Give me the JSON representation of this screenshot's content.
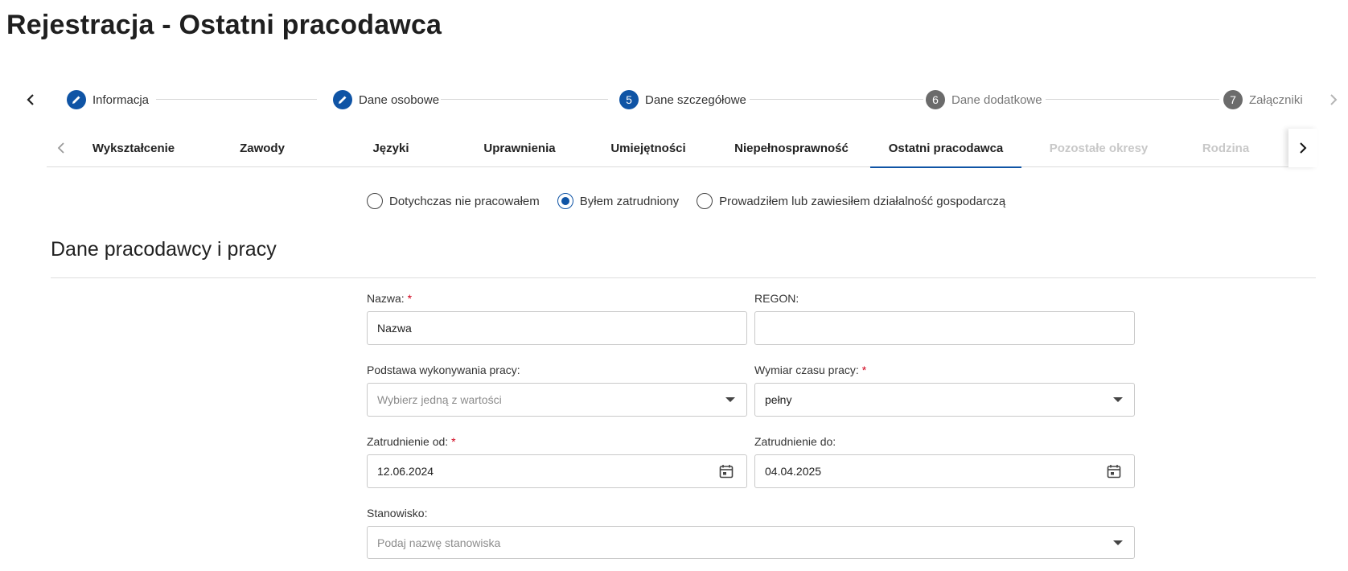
{
  "page": {
    "title": "Rejestracja - Ostatni pracodawca"
  },
  "stepper": {
    "prev_icon": "chevron-left-icon",
    "next_icon": "chevron-right-icon",
    "steps": [
      {
        "label": "Informacja",
        "state": "done",
        "icon": "pencil-icon"
      },
      {
        "label": "Dane osobowe",
        "state": "done",
        "icon": "pencil-icon"
      },
      {
        "label": "Dane szczegółowe",
        "state": "active",
        "number": "5"
      },
      {
        "label": "Dane dodatkowe",
        "state": "todo",
        "number": "6"
      },
      {
        "label": "Załączniki",
        "state": "todo",
        "number": "7"
      }
    ]
  },
  "tabs": {
    "items": [
      {
        "label": "Wykształcenie"
      },
      {
        "label": "Zawody"
      },
      {
        "label": "Języki"
      },
      {
        "label": "Uprawnienia"
      },
      {
        "label": "Umiejętności"
      },
      {
        "label": "Niepełnosprawność"
      },
      {
        "label": "Ostatni pracodawca",
        "active": true
      },
      {
        "label": "Pozostałe okresy",
        "disabled": true
      },
      {
        "label": "Rodzina",
        "disabled": true
      }
    ]
  },
  "employment_status": {
    "options": [
      {
        "label": "Dotychczas nie pracowałem",
        "checked": false
      },
      {
        "label": "Byłem zatrudniony",
        "checked": true
      },
      {
        "label": "Prowadziłem lub zawiesiłem działalność gospodarczą",
        "checked": false
      }
    ]
  },
  "section": {
    "title": "Dane pracodawcy i pracy"
  },
  "form": {
    "name": {
      "label": "Nazwa:",
      "required_mark": "*",
      "value": "Nazwa"
    },
    "regon": {
      "label": "REGON:",
      "value": ""
    },
    "basis": {
      "label": "Podstawa wykonywania pracy:",
      "placeholder": "Wybierz jedną z wartości"
    },
    "working_time": {
      "label": "Wymiar czasu pracy:",
      "required_mark": "*",
      "value": "pełny"
    },
    "employed_from": {
      "label": "Zatrudnienie od:",
      "required_mark": "*",
      "value": "12.06.2024"
    },
    "employed_to": {
      "label": "Zatrudnienie do:",
      "value": "04.04.2025"
    },
    "position": {
      "label": "Stanowisko:",
      "placeholder": "Podaj nazwę stanowiska"
    }
  },
  "colors": {
    "accent": "#0f54a5",
    "required": "#d0021b",
    "inactive_step": "#6b6b6b"
  }
}
